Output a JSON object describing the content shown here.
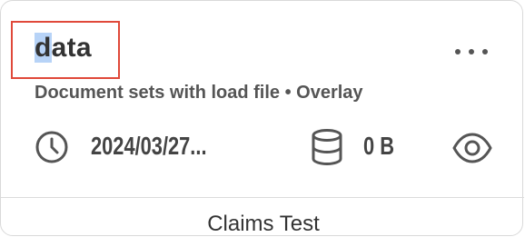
{
  "card": {
    "title_highlight": "d",
    "title_rest": "ata",
    "subtitle": "Document sets with load file • Overlay",
    "date": "2024/03/27...",
    "size": "0 B",
    "footer_label": "Claims Test"
  },
  "icons": {
    "more": "more-horizontal-icon",
    "clock": "clock-icon",
    "storage": "database-icon",
    "view": "eye-icon"
  },
  "colors": {
    "highlight_box": "#e0493a",
    "selection": "#b7d3f7"
  }
}
